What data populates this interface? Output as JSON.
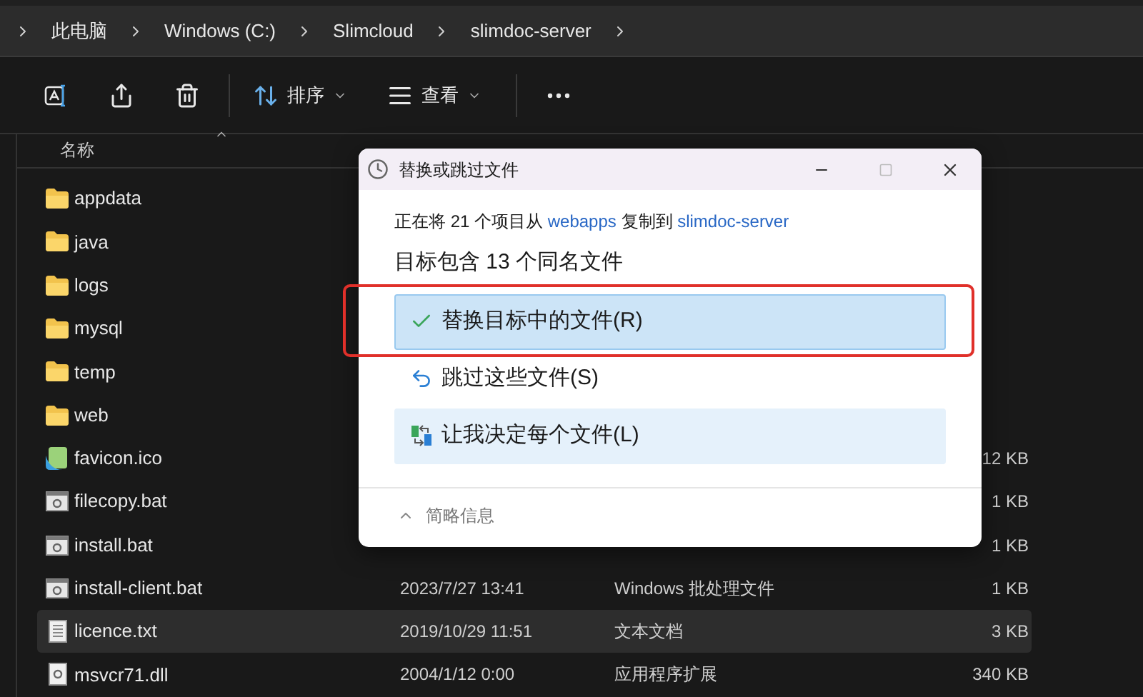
{
  "breadcrumb": [
    "此电脑",
    "Windows (C:)",
    "Slimcloud",
    "slimdoc-server"
  ],
  "toolbar": [
    {
      "kind": "rename"
    },
    {
      "kind": "share"
    },
    {
      "kind": "delete"
    },
    {
      "kind": "sort",
      "label": "排序"
    },
    {
      "kind": "view",
      "label": "查看"
    },
    {
      "kind": "more"
    }
  ],
  "table": {
    "columns": [
      "名称"
    ],
    "rows": [
      {
        "name": "appdata",
        "kind": "folder",
        "selected": false
      },
      {
        "name": "java",
        "kind": "folder",
        "selected": false
      },
      {
        "name": "logs",
        "kind": "folder",
        "selected": false
      },
      {
        "name": "mysql",
        "kind": "folder",
        "selected": false
      },
      {
        "name": "temp",
        "kind": "folder",
        "selected": false
      },
      {
        "name": "web",
        "kind": "folder",
        "selected": false
      },
      {
        "name": "favicon.ico",
        "kind": "image",
        "size": "12 KB",
        "selected": false
      },
      {
        "name": "filecopy.bat",
        "kind": "batch",
        "size": "1 KB",
        "selected": false
      },
      {
        "name": "install.bat",
        "kind": "batch",
        "size": "1 KB",
        "selected": false
      },
      {
        "name": "install-client.bat",
        "kind": "batch",
        "date": "2023/7/27 13:41",
        "type": "Windows 批处理文件",
        "size": "1 KB",
        "selected": false
      },
      {
        "name": "licence.txt",
        "kind": "text",
        "date": "2019/10/29 11:51",
        "type": "文本文档",
        "size": "3 KB",
        "selected": true
      },
      {
        "name": "msvcr71.dll",
        "kind": "dll",
        "date": "2004/1/12 0:00",
        "type": "应用程序扩展",
        "size": "340 KB",
        "selected": false
      }
    ]
  },
  "dialog": {
    "title": "替换或跳过文件",
    "copy_line": {
      "prefix": "正在将 21 个项目从",
      "source": "webapps",
      "middle": "复制到",
      "target": "slimdoc-server"
    },
    "heading": "目标包含 13 个同名文件",
    "options": [
      {
        "kind": "replace",
        "label": "替换目标中的文件(R)",
        "selected": true,
        "hovered": false
      },
      {
        "kind": "skip",
        "label": "跳过这些文件(S)",
        "selected": false,
        "hovered": false
      },
      {
        "kind": "decide",
        "label": "让我决定每个文件(L)",
        "selected": false,
        "hovered": true
      }
    ],
    "details_toggle": "简略信息"
  }
}
